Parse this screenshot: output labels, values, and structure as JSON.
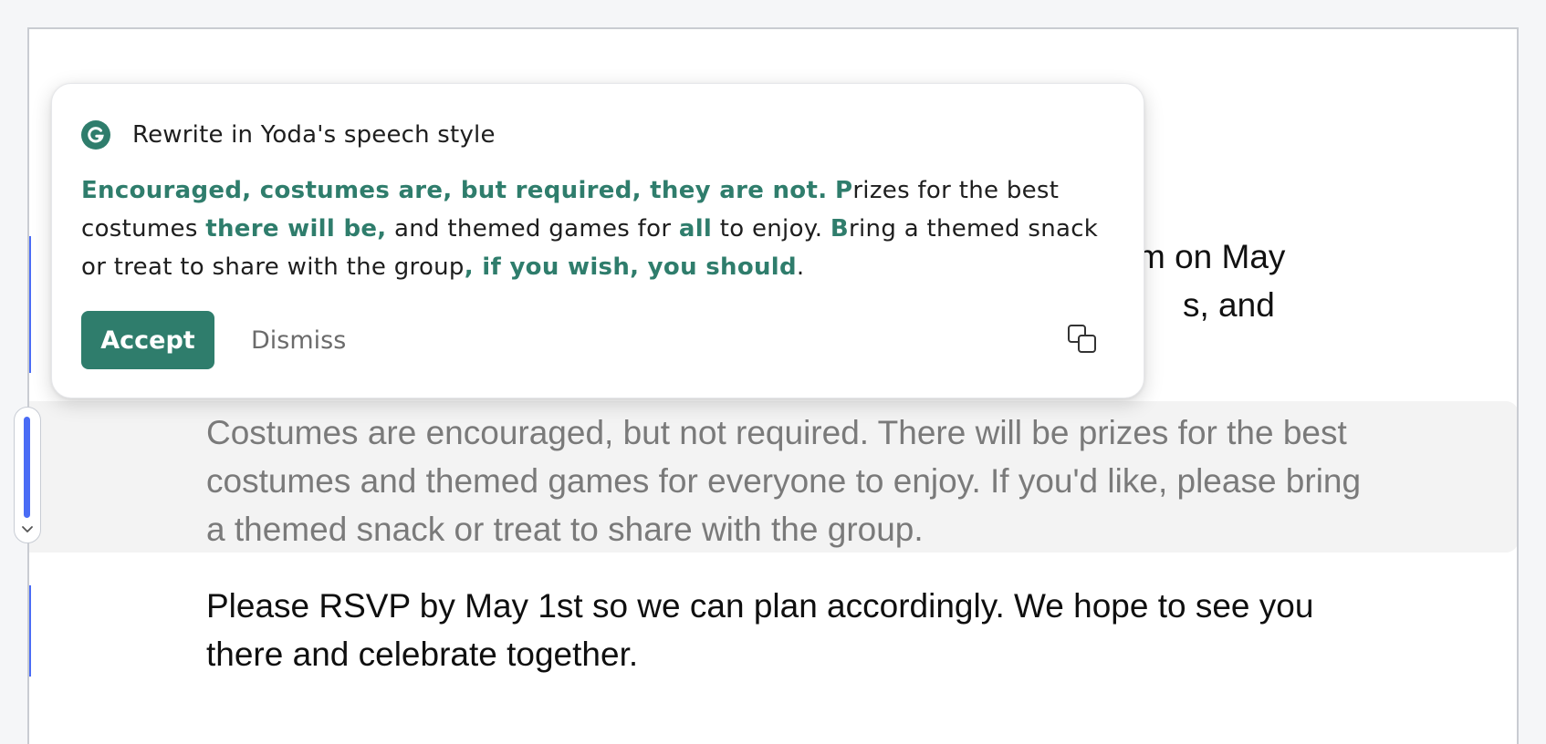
{
  "document": {
    "paragraph1": {
      "line1_fragment": "m on May",
      "line2_fragment": "s, and"
    },
    "paragraph2": "Costumes are encouraged, but not required. There will be prizes for the best costumes and themed games for everyone to enjoy. If you'd like, please bring a themed snack or treat to share with the group.",
    "paragraph3": "Please RSVP by May 1st so we can plan accordingly. We hope to see you there and celebrate together."
  },
  "popover": {
    "title": "Rewrite in Yoda's speech style",
    "suggestion": {
      "s1": "Encouraged, costumes are, but required, they are not.",
      "s2": " ",
      "s3": "P",
      "s4": "rizes for the best costumes ",
      "s5": "there will be,",
      "s6": " and themed games for ",
      "s7": "all",
      "s8": " to enjoy. ",
      "s9": "B",
      "s10": "ring a themed snack or treat to share with the group",
      "s11": ", if you wish, you should",
      "s12": "."
    },
    "accept_label": "Accept",
    "dismiss_label": "Dismiss",
    "copy_icon": "copy-icon",
    "logo_icon": "grammarly-logo-icon"
  },
  "colors": {
    "accent": "#2f7d6c",
    "margin_bar": "#4a6cf5",
    "highlight_band": "#f3f3f3",
    "muted_text": "#7a7a7a"
  }
}
